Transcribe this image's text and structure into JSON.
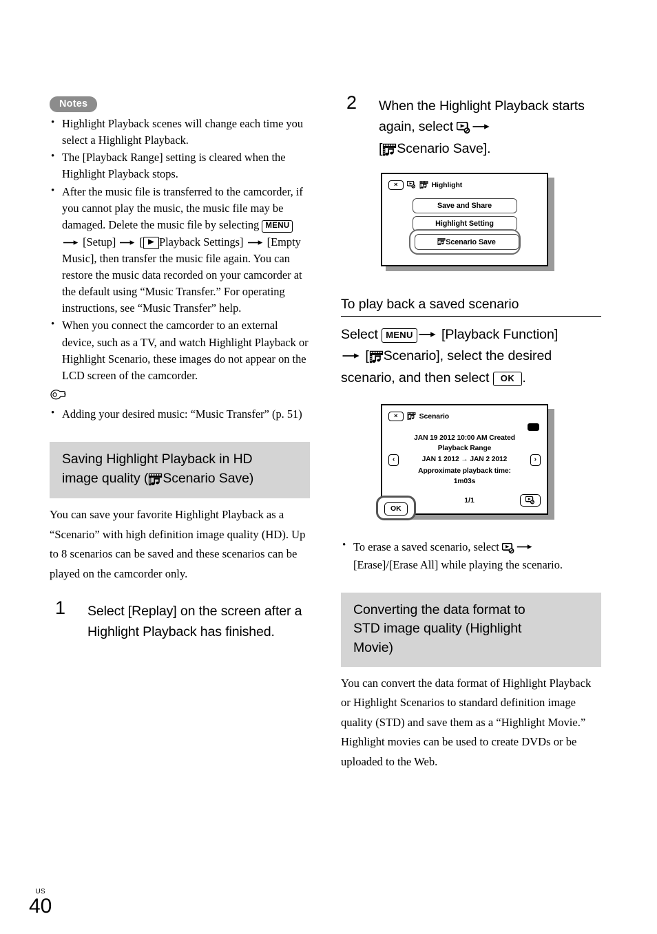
{
  "page": {
    "locale_code": "US",
    "page_number": "40"
  },
  "left_column": {
    "notes_badge": "Notes",
    "notes": [
      {
        "id": "note-1",
        "parts": [
          {
            "type": "text",
            "value": "Highlight Playback scenes will change each time you select a Highlight Playback."
          }
        ]
      },
      {
        "id": "note-2",
        "parts": [
          {
            "type": "text",
            "value": "The [Playback Range] setting is cleared when the Highlight Playback stops."
          }
        ]
      },
      {
        "id": "note-3",
        "parts": [
          {
            "type": "text",
            "value": "After the music file is transferred to the camcorder, if you cannot play the music, the music file may be damaged. Delete the music file by selecting "
          },
          {
            "type": "glyph",
            "value": "MENU"
          },
          {
            "type": "arrow"
          },
          {
            "type": "text",
            "value": " [Setup] "
          },
          {
            "type": "arrow"
          },
          {
            "type": "text",
            "value": " ["
          },
          {
            "type": "glyph",
            "value": "play"
          },
          {
            "type": "text",
            "value": "Playback Settings] "
          },
          {
            "type": "arrow"
          },
          {
            "type": "text",
            "value": " [Empty Music], then transfer the music file again. You can restore the music data recorded on your camcorder at the default using “Music Transfer.” For operating instructions, see “Music Transfer” help."
          }
        ]
      },
      {
        "id": "note-4",
        "parts": [
          {
            "type": "text",
            "value": "When you connect the camcorder to an external device, such as a TV, and watch Highlight Playback or Highlight Scenario, these images do not appear on the LCD screen of the camcorder."
          }
        ]
      }
    ],
    "tip_icon": "pointing-hand-icon",
    "tips": [
      {
        "id": "tip-1",
        "text": "Adding your desired music: “Music Transfer” (p. 51)"
      }
    ],
    "section_heading": {
      "line1": "Saving Highlight Playback in HD",
      "line2_pre": "image quality (",
      "icon": "scenario-icon",
      "line2_post": "Scenario Save)"
    },
    "section_body": "You can save your favorite Highlight Playback as a “Scenario” with high definition image quality (HD). Up to 8 scenarios can be saved and these scenarios can be played on the camcorder only.",
    "step1": {
      "number": "1",
      "text": "Select [Replay] on the screen after a Highlight Playback has finished."
    }
  },
  "right_column": {
    "step2": {
      "number": "2",
      "text_part1": "When the Highlight Playback starts again, select ",
      "icon_options": "options-icon",
      "text_part2": " [",
      "icon_scenario": "scenario-icon",
      "text_part3": "Scenario Save]."
    },
    "screen_highlight": {
      "close_button": "×",
      "icon_options": "options-icon",
      "icon_scenario": "scenario-icon",
      "title": "Highlight",
      "buttons": [
        {
          "label": "Save and Share",
          "selected": false,
          "icon": null
        },
        {
          "label": "Highlight Setting",
          "selected": false,
          "icon": null
        },
        {
          "label": "Scenario Save",
          "selected": true,
          "icon": "scenario-icon"
        }
      ]
    },
    "playback_section": {
      "heading": "To play back a saved scenario",
      "body_parts": [
        {
          "type": "text",
          "value": "Select "
        },
        {
          "type": "glyph",
          "value": "MENU"
        },
        {
          "type": "arrow"
        },
        {
          "type": "text",
          "value": " [Playback Function] "
        },
        {
          "type": "arrow"
        },
        {
          "type": "text",
          "value": " ["
        },
        {
          "type": "glyph",
          "value": "scenario-icon"
        },
        {
          "type": "text",
          "value": "Scenario], select the desired scenario, and then select "
        },
        {
          "type": "glyph",
          "value": "OK"
        },
        {
          "type": "text",
          "value": "."
        }
      ]
    },
    "screen_scenario": {
      "close_button": "×",
      "icon_scenario": "scenario-icon",
      "title": "Scenario",
      "battery_icon": "battery-icon",
      "created_line": "JAN  19  2012  10:00 AM Created",
      "range_label": "Playback Range",
      "prev_button": "‹",
      "range_value": "JAN   1  2012  →  JAN   2  2012",
      "next_button": "›",
      "approx_label": "Approximate playback time:",
      "approx_value": "1m03s",
      "ok_button": "OK",
      "page_count": "1/1",
      "options_button": "options-icon"
    },
    "erase_note": {
      "part1": "To erase a saved scenario, select ",
      "icon": "options-icon",
      "part2": " [Erase]/[Erase All] while playing the scenario."
    },
    "section_heading2": {
      "line1": "Converting the data format to",
      "line2": "STD image quality (Highlight",
      "line3": "Movie)"
    },
    "section_body2": "You can convert the data format of Highlight Playback or Highlight Scenarios to standard definition image quality (STD) and save them as a “Highlight Movie.” Highlight movies can be used to create DVDs or be uploaded to the Web."
  },
  "colors": {
    "heading_bg": "#d4d4d4",
    "notes_pill_bg": "#8c8c8c",
    "screen_shadow": "#9a9a9a",
    "selection_ring": "#6b6b6b"
  }
}
